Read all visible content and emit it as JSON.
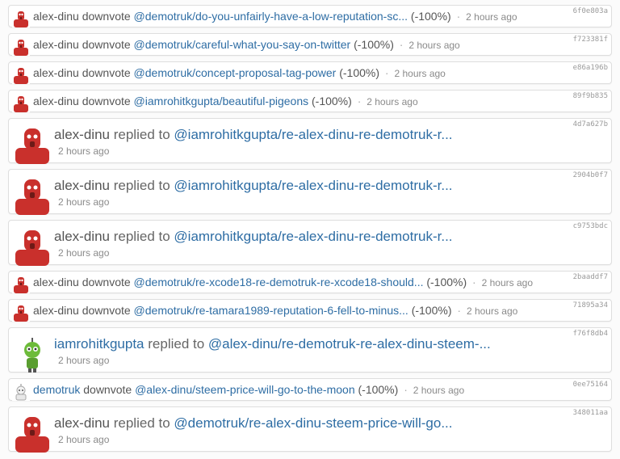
{
  "feed": [
    {
      "kind": "vote",
      "user": "alex-dinu",
      "action": "downvote",
      "target": "@demotruk/do-you-unfairly-have-a-low-reputation-sc...",
      "pct": "(-100%)",
      "time": "2 hours ago",
      "hash": "6f0e803a",
      "avatar": "red-robot"
    },
    {
      "kind": "vote",
      "user": "alex-dinu",
      "action": "downvote",
      "target": "@demotruk/careful-what-you-say-on-twitter",
      "pct": "(-100%)",
      "time": "2 hours ago",
      "hash": "f723381f",
      "avatar": "red-robot"
    },
    {
      "kind": "vote",
      "user": "alex-dinu",
      "action": "downvote",
      "target": "@demotruk/concept-proposal-tag-power",
      "pct": "(-100%)",
      "time": "2 hours ago",
      "hash": "e86a196b",
      "avatar": "red-robot"
    },
    {
      "kind": "vote",
      "user": "alex-dinu",
      "action": "downvote",
      "target": "@iamrohitkgupta/beautiful-pigeons",
      "pct": "(-100%)",
      "time": "2 hours ago",
      "hash": "89f9b835",
      "avatar": "red-robot"
    },
    {
      "kind": "reply",
      "user": "alex-dinu",
      "action": "replied to",
      "target": "@iamrohitkgupta/re-alex-dinu-re-demotruk-r...",
      "time": "2 hours ago",
      "hash": "4d7a627b",
      "avatar": "red-robot"
    },
    {
      "kind": "reply",
      "user": "alex-dinu",
      "action": "replied to",
      "target": "@iamrohitkgupta/re-alex-dinu-re-demotruk-r...",
      "time": "2 hours ago",
      "hash": "2904b0f7",
      "avatar": "red-robot"
    },
    {
      "kind": "reply",
      "user": "alex-dinu",
      "action": "replied to",
      "target": "@iamrohitkgupta/re-alex-dinu-re-demotruk-r...",
      "time": "2 hours ago",
      "hash": "c9753bdc",
      "avatar": "red-robot"
    },
    {
      "kind": "vote",
      "user": "alex-dinu",
      "action": "downvote",
      "target": "@demotruk/re-xcode18-re-demotruk-re-xcode18-should...",
      "pct": "(-100%)",
      "time": "2 hours ago",
      "hash": "2baaddf7",
      "avatar": "red-robot"
    },
    {
      "kind": "vote",
      "user": "alex-dinu",
      "action": "downvote",
      "target": "@demotruk/re-tamara1989-reputation-6-fell-to-minus...",
      "pct": "(-100%)",
      "time": "2 hours ago",
      "hash": "71895a34",
      "avatar": "red-robot"
    },
    {
      "kind": "reply",
      "user": "iamrohitkgupta",
      "action": "replied to",
      "target": "@alex-dinu/re-demotruk-re-alex-dinu-steem-...",
      "time": "2 hours ago",
      "hash": "f76f8db4",
      "avatar": "green-robot"
    },
    {
      "kind": "vote",
      "user": "demotruk",
      "action": "downvote",
      "target": "@alex-dinu/steem-price-will-go-to-the-moon",
      "pct": "(-100%)",
      "time": "2 hours ago",
      "hash": "0ee75164",
      "avatar": "white-robot"
    },
    {
      "kind": "reply",
      "user": "alex-dinu",
      "action": "replied to",
      "target": "@demotruk/re-alex-dinu-steem-price-will-go...",
      "time": "2 hours ago",
      "hash": "348011aa",
      "avatar": "red-robot"
    }
  ],
  "separator": "·",
  "colors": {
    "link": "#2e6da4",
    "text": "#555555",
    "muted": "#8a8a8a",
    "border": "#dedede"
  }
}
